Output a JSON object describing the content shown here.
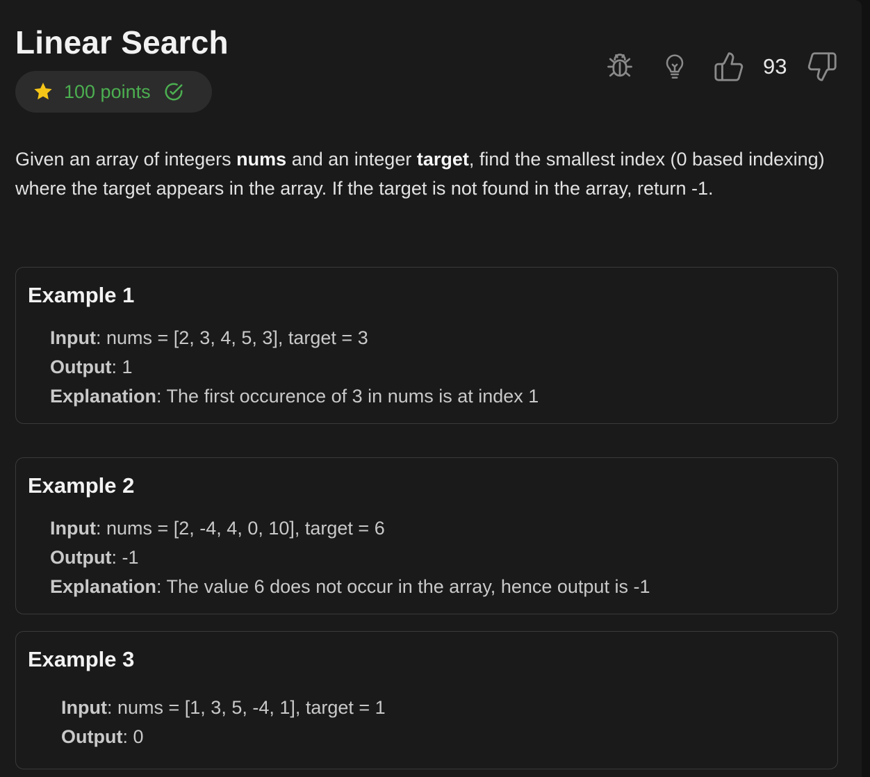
{
  "problem": {
    "title": "Linear Search",
    "points_label": "100 points",
    "likes": "93",
    "description": {
      "part1": "Given an array of integers ",
      "bold1": "nums",
      "part2": " and an integer ",
      "bold2": "target",
      "part3": ", find the smallest index (0 based indexing) where the target appears in the array. If the target is not found in the array, return -1."
    }
  },
  "labels": {
    "input": "Input",
    "output": "Output",
    "explanation": "Explanation"
  },
  "examples": [
    {
      "title": "Example 1",
      "input": ": nums = [2, 3, 4, 5, 3], target = 3",
      "output": ": 1",
      "explanation": ": The first occurence of 3 in nums is at index 1"
    },
    {
      "title": "Example 2",
      "input": ": nums = [2, -4, 4, 0, 10], target = 6",
      "output": ": -1",
      "explanation": ": The value 6 does not occur in the array, hence output is -1"
    },
    {
      "title": "Example 3",
      "input": ": nums = [1, 3, 5, -4, 1], target = 1",
      "output": ": 0"
    }
  ],
  "icons": {
    "star": "star-icon",
    "check": "check-circle-icon",
    "bug": "bug-icon",
    "hint": "lightbulb-icon",
    "like": "thumbs-up-icon",
    "dislike": "thumbs-down-icon"
  },
  "colors": {
    "points": "#4caf50",
    "star": "#f5c518",
    "background": "#1a1a1a"
  }
}
